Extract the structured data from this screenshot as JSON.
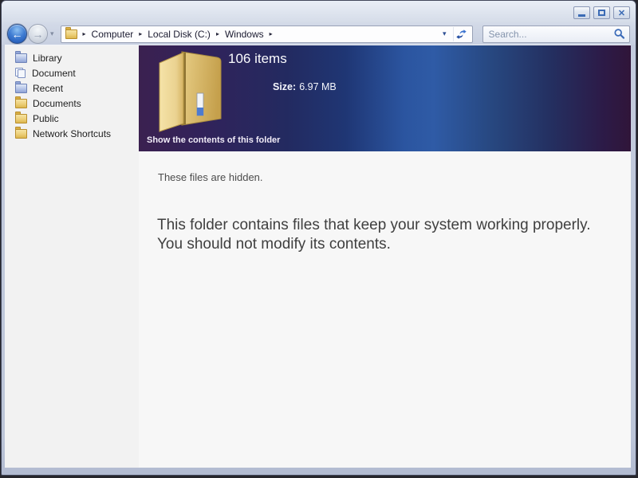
{
  "breadcrumb": {
    "items": [
      "Computer",
      "Local Disk (C:)",
      "Windows"
    ]
  },
  "search": {
    "placeholder": "Search..."
  },
  "sidebar": {
    "items": [
      {
        "label": "Library",
        "icon": "folder-blue-icon"
      },
      {
        "label": "Document",
        "icon": "documents-stack-icon"
      },
      {
        "label": "Recent",
        "icon": "folder-blue-icon"
      },
      {
        "label": "Documents",
        "icon": "folder-yellow-icon"
      },
      {
        "label": "Public",
        "icon": "folder-yellow-icon"
      },
      {
        "label": "Network Shortcuts",
        "icon": "folder-yellow-icon"
      }
    ]
  },
  "folder_header": {
    "item_count": "106 items",
    "size_label": "Size:",
    "size_value": "6.97 MB",
    "action_text": "Show the contents of this folder"
  },
  "content": {
    "hidden_notice": "These files are hidden.",
    "warning": "This folder contains files that keep your system working properly. You should not modify its contents."
  },
  "icons": {
    "back": "←",
    "forward": "→",
    "history_chevron": "▾",
    "breadcrumb_separator": "▸",
    "address_dropdown": "▾",
    "close": "✕"
  },
  "colors": {
    "header_gradient_left": "#3b2150",
    "header_gradient_mid": "#2f5ba6",
    "header_gradient_right": "#301539",
    "frame": "#c8d0e1",
    "accent_blue": "#3b6bb5"
  }
}
